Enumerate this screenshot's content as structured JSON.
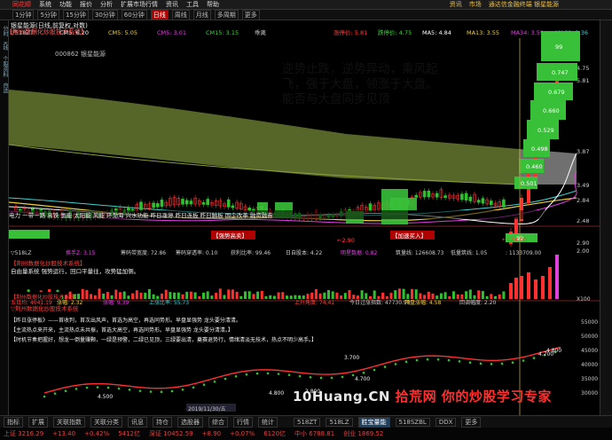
{
  "menubar": {
    "brand": "同花顺",
    "items": [
      "系统",
      "功能",
      "报价",
      "分析",
      "扩展市场行情",
      "资讯",
      "工具",
      "帮助"
    ],
    "right_items": [
      "资讯",
      "市场",
      "通达信金融终端 银星能源"
    ]
  },
  "toolbar": {
    "periods": [
      "1分钟",
      "5分钟",
      "15分钟",
      "30分钟",
      "60分钟",
      "日线",
      "周线",
      "月线",
      "多周期",
      "更多"
    ],
    "active_period": "日线"
  },
  "chart": {
    "title_line": "银星能源(日线,前复权,对数)",
    "ma_items": [
      {
        "text": "▽518ZT",
        "color": "#cccccc"
      },
      {
        "text": "CM5: 6.20",
        "color": "#ffffff"
      },
      {
        "text": "CM5: 5.05",
        "color": "#f0d040"
      },
      {
        "text": "CM5: 3.01",
        "color": "#e040e0"
      },
      {
        "text": "CM15: 3.15",
        "color": "#40d040"
      },
      {
        "text": "乖离",
        "color": "#cccccc"
      }
    ],
    "ma_right": [
      {
        "text": "涨停价: 5.81",
        "color": "#ff4040"
      },
      {
        "text": "跌停价: 4.75",
        "color": "#40d040"
      },
      {
        "text": "MA5: 4.84",
        "color": "#ffffff"
      },
      {
        "text": "MA13: 3.55",
        "color": "#f0d040"
      },
      {
        "text": "MA34: 3.59",
        "color": "#e040e0"
      },
      {
        "text": "MA60: 3.36",
        "color": "#40d0d0"
      }
    ],
    "overlay_title": "【荆州数据化炒股技术系统】",
    "stock_code": "000862  银星能源",
    "annotation": "逆势止跌，逆势异动，乘风起飞，强于大盘，领涨于大盘。能否与大盘同步见顶",
    "price_labels": [
      "5.81",
      "4.75",
      "3.87",
      "3.49",
      "2.84",
      "2.48",
      "2.90",
      "2.00"
    ],
    "low_label": "←2.90",
    "low_label2": "←124.00",
    "mid_banner": "电力 一带一路 高铁 氢能 太阳能 风能 环渤海 兴水功能 昨日涨停 昨日连板 昨日触板 国企改革 融资融券",
    "mid_tags": [
      "【强势高卖】",
      "【加速买入】"
    ],
    "box_values": [
      "99",
      "0.747",
      "0.679",
      "0.660",
      "0.529",
      "0.498",
      "0.460",
      "0.501",
      "99"
    ],
    "vol_header": [
      {
        "text": "▽518LZ",
        "color": "#cccccc"
      },
      {
        "text": "换手Z: 3.15",
        "color": "#e040e0"
      },
      {
        "text": "筹码带宽度: 72.86",
        "color": "#cccccc"
      },
      {
        "text": "筹码穿透率: 0.10",
        "color": "#cccccc"
      },
      {
        "text": "获利比率: 99.46",
        "color": "#cccccc"
      },
      {
        "text": "日自股本: 4.22",
        "color": "#cccccc"
      },
      {
        "text": "明星数据: 0.82",
        "color": "#e040e0"
      },
      {
        "text": "筑量线: 126608.73",
        "color": "#cccccc"
      },
      {
        "text": "低量筑线: 1.05",
        "color": "#cccccc"
      },
      {
        "text": ": 1133709.00",
        "color": "#cccccc"
      }
    ],
    "vol_title": "【荆州数据化炒股技术系统】",
    "vol_sub": "自由量系统 强势运行，回口平量往，攻势猛加侧。",
    "vol_tick": "X100",
    "lower_title": "▽荆州数据化炒股技术系统",
    "lower_right": [
      {
        "text": "上升角度: 74.41",
        "color": "#ff4040"
      },
      {
        "text": "今日过涨指数: 47730.98",
        "color": "#cccccc"
      },
      {
        "text": "开盘涨幅: 4.58",
        "color": "#f0d040"
      },
      {
        "text": "回调幅度: 2.20",
        "color": "#cccccc"
      }
    ],
    "lower_left": [
      {
        "text": "五日均: 4041.19",
        "color": "#ff4040"
      },
      {
        "text": "涨幅: 2.32",
        "color": "#f0d040"
      },
      {
        "text": "涨幅: 9.39",
        "color": "#e040e0"
      },
      {
        "text": "上涨比率: 55.73",
        "color": "#40d0d0"
      }
    ],
    "lower_notes": [
      "【昨日涨停板》——首收判，首次出风声，首选为高空，再选同势形。早盘显强势 龙头要分清清。",
      "【主流热点来开来，主流热点未共振，首选大高空，再选同势形。早盘显强势 龙头要分清清。】",
      "【时机节奏把握好，想龙一倒量赚颗，一绿是预警，二绿已见顶，三绿要出清，奠赛退势行，情绪清淡无技术，热点不明少高手。】"
    ],
    "lower_numbers": [
      "4.500",
      "3.700",
      "4.800",
      "3.800",
      "4.700",
      "4.800",
      "4.700"
    ],
    "lower_scale": [
      "55000",
      "50000",
      "45000",
      "40000",
      "35000",
      "30000"
    ],
    "date_label": "2019/11/30/五",
    "watermark_a": "10Huang.CN ",
    "watermark_b": "拾荒网 你的炒股学习专家"
  },
  "statusbar": {
    "tabs": [
      "指标",
      "扩展",
      "关联指数",
      "关联分类",
      "讯息",
      "持仓",
      "选股器",
      "综合",
      "行情",
      "统计"
    ],
    "mid_tabs": [
      "518ZT",
      "518LZ",
      "胜宝量能",
      "518SZBL",
      "DDX",
      "更多"
    ]
  },
  "bottombar": {
    "items": [
      "上证 3216.29",
      "+13.40",
      "+0.42%",
      "5412亿",
      "深证 10452.59",
      "+8.90",
      "+0.07%",
      "6120亿",
      "中小 6788.81",
      "创业 1869.52"
    ]
  },
  "colors": {
    "up": "#ff3030",
    "down": "#30c030",
    "bg": "#000000",
    "band": "#5a6e2a",
    "box": "#38c038"
  }
}
